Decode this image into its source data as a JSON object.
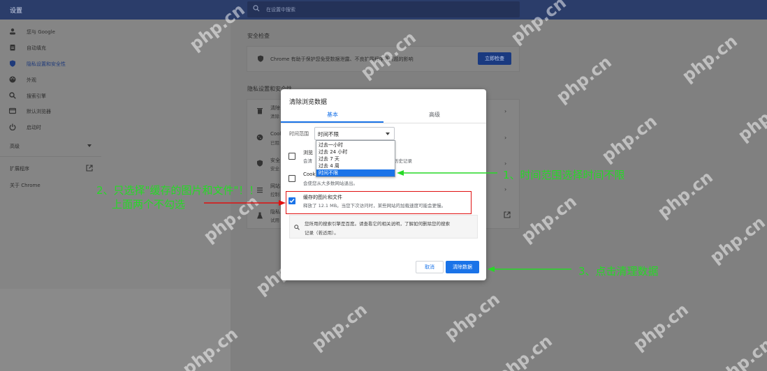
{
  "app": {
    "title": "设置"
  },
  "search": {
    "placeholder": "在设置中搜索"
  },
  "sidebar": {
    "items": [
      {
        "label": "您与 Google",
        "icon": "person-icon"
      },
      {
        "label": "自动填充",
        "icon": "clipboard-icon"
      },
      {
        "label": "隐私设置和安全性",
        "icon": "shield-icon"
      },
      {
        "label": "外观",
        "icon": "palette-icon"
      },
      {
        "label": "搜索引擎",
        "icon": "search-icon"
      },
      {
        "label": "默认浏览器",
        "icon": "browser-icon"
      },
      {
        "label": "启动时",
        "icon": "power-icon"
      }
    ],
    "advanced": "高级",
    "extensions": "扩展程序",
    "about": "关于 Chrome"
  },
  "main": {
    "safety_title": "安全检查",
    "safety_text": "Chrome 有助于保护您免受数据泄露、不良扩展程序等问题的影响",
    "safety_button": "立即检查",
    "privacy_title": "隐私设置和安全性",
    "rows": [
      {
        "title": "清除",
        "sub": "清除"
      },
      {
        "title": "Cook",
        "sub": "已阻"
      },
      {
        "title": "安全",
        "sub": "安全"
      },
      {
        "title": "网站",
        "sub": "控制"
      },
      {
        "title": "隐私",
        "sub": "试用"
      }
    ]
  },
  "dialog": {
    "title": "清除浏览数据",
    "tabs": [
      "基本",
      "高级"
    ],
    "range_label": "时间范围",
    "range_value": "时间不限",
    "range_options": [
      "过去一小时",
      "过去 24 小时",
      "过去 7 天",
      "过去 4 周",
      "时间不限"
    ],
    "history_title": "浏览",
    "history_desc": "会清",
    "history_desc_tail": "历史记录",
    "cookies_title": "Cook",
    "cookies_desc": "会使您从大多数网站退出。",
    "cache_title": "缓存的图片和文件",
    "cache_desc": "释放了 12.1 MB。当您下次访问时，某些网站的加载速度可能会更慢。",
    "note_line1": "您所用的搜索引擎是百度。请查看它的相关说明，了解如何删除您的搜索",
    "note_line2": "记录（若适用）。",
    "cancel": "取消",
    "clear": "清除数据"
  },
  "annotations": {
    "step1": "1、时间范围选择时间不限",
    "step2_line1": "2、只选择\"缓存的图片和文件\"！！",
    "step2_line2": "上面两个不勾选",
    "step3": "3、点击清理数据",
    "green": "#26d926",
    "red": "#e01010"
  },
  "watermark": "php.cn",
  "colors": {
    "accent": "#1a73e8",
    "header": "#2b3d6a"
  }
}
